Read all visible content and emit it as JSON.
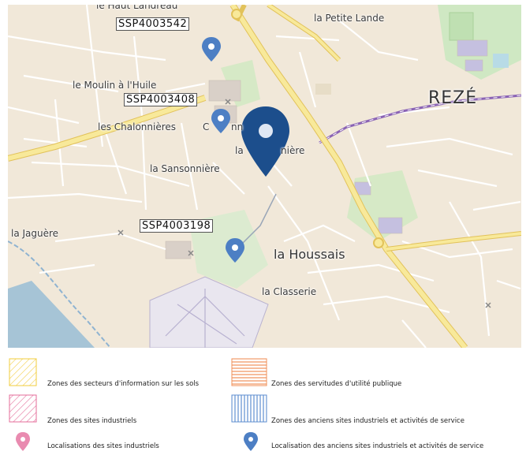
{
  "map": {
    "place_names": {
      "top_partial": "le Haut Landreau",
      "petite_lande": "la Petite Lande",
      "reze": "REZÉ",
      "moulin": "le Moulin à l'Huile",
      "chalonnieres": "les Chalonnières",
      "c_partial": "C",
      "nn_partial": "nn",
      "houssais_center": "la",
      "niere": "nière",
      "sansonniere": "la Sansonnière",
      "jaguere": "la Jaguère",
      "houssais": "la Houssais",
      "classerie": "la Classerie"
    },
    "site_codes": {
      "code1": "SSP4003542",
      "code2": "SSP4003408",
      "code3": "SSP4003198"
    },
    "marker_icons": {
      "main": "map-pin-icon",
      "small": "map-pin-icon"
    },
    "colors": {
      "main_pin": "#1c4e8c",
      "small_pin": "#4d7fc4",
      "industrial_pin": "#e98bb0",
      "road_major": "#f7e38a",
      "road_edge": "#e3c55c",
      "rail": "#7a4d9c",
      "water": "#9fc1d9"
    }
  },
  "legend": {
    "items": [
      {
        "label": "Zones des secteurs d'information sur les sols",
        "color": "#f2cc3d",
        "pattern": "diagonal"
      },
      {
        "label": "Zones des servitudes d'utilité publique",
        "color": "#f0905a",
        "pattern": "horizontal"
      },
      {
        "label": "Zones des sites industriels",
        "color": "#e46c9a",
        "pattern": "diagonal"
      },
      {
        "label": "Zones des anciens sites industriels et activités de service",
        "color": "#5f8fd0",
        "pattern": "vertical"
      },
      {
        "label": "Localisations des sites industriels",
        "color": "#e98bb0",
        "pattern": "pin"
      },
      {
        "label": "Localisation des anciens sites industriels et activités de service",
        "color": "#4d7fc4",
        "pattern": "pin"
      }
    ]
  }
}
